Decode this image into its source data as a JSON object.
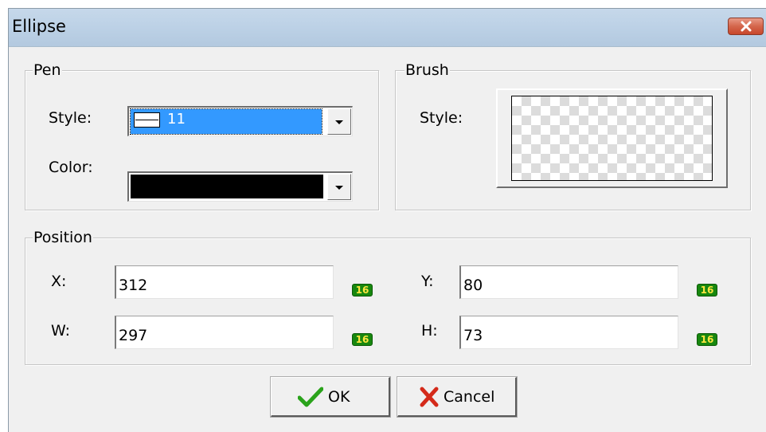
{
  "window": {
    "title": "Ellipse",
    "close_icon": "close-icon"
  },
  "pen": {
    "group_label": "Pen",
    "style_label": "Style:",
    "style_value": "11",
    "color_label": "Color:",
    "color_value": "#000000"
  },
  "brush": {
    "group_label": "Brush",
    "style_label": "Style:",
    "pattern": "transparent-checkerboard"
  },
  "position": {
    "group_label": "Position",
    "x_label": "X:",
    "x_value": "312",
    "y_label": "Y:",
    "y_value": "80",
    "w_label": "W:",
    "w_value": "297",
    "h_label": "H:",
    "h_value": "73",
    "badge_text": "16"
  },
  "buttons": {
    "ok_label": "OK",
    "ok_icon": "checkmark-icon",
    "cancel_label": "Cancel",
    "cancel_icon": "x-mark-icon"
  },
  "colors": {
    "selection": "#3399ff",
    "badge_bg": "#17870f",
    "badge_text": "#ffe640",
    "ok_icon": "#2aa31b",
    "cancel_icon": "#d42a1a"
  }
}
